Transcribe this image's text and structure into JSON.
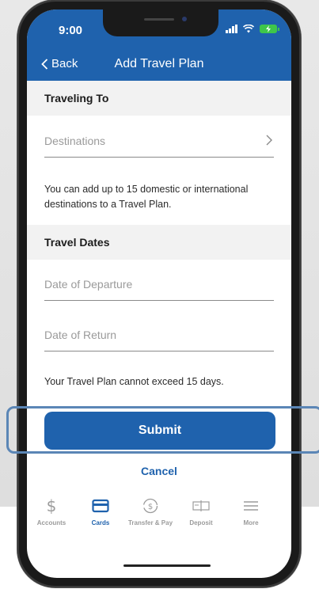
{
  "status": {
    "time": "9:00"
  },
  "nav": {
    "back_label": "Back",
    "title": "Add Travel Plan"
  },
  "traveling_to": {
    "header": "Traveling To",
    "destinations_placeholder": "Destinations",
    "helper": "You can add up to 15 domestic or international destinations to a Travel Plan."
  },
  "travel_dates": {
    "header": "Travel Dates",
    "departure_placeholder": "Date of Departure",
    "return_placeholder": "Date of Return",
    "helper": "Your Travel Plan cannot exceed 15 days."
  },
  "actions": {
    "submit_label": "Submit",
    "cancel_label": "Cancel"
  },
  "tabbar": {
    "items": [
      {
        "label": "Accounts",
        "icon": "dollar-icon",
        "active": false
      },
      {
        "label": "Cards",
        "icon": "card-icon",
        "active": true
      },
      {
        "label": "Transfer & Pay",
        "icon": "transfer-icon",
        "active": false
      },
      {
        "label": "Deposit",
        "icon": "check-deposit-icon",
        "active": false
      },
      {
        "label": "More",
        "icon": "menu-icon",
        "active": false
      }
    ]
  },
  "colors": {
    "brand": "#1f62ad",
    "highlight": "#5b86b6",
    "battery": "#3ec64a"
  }
}
